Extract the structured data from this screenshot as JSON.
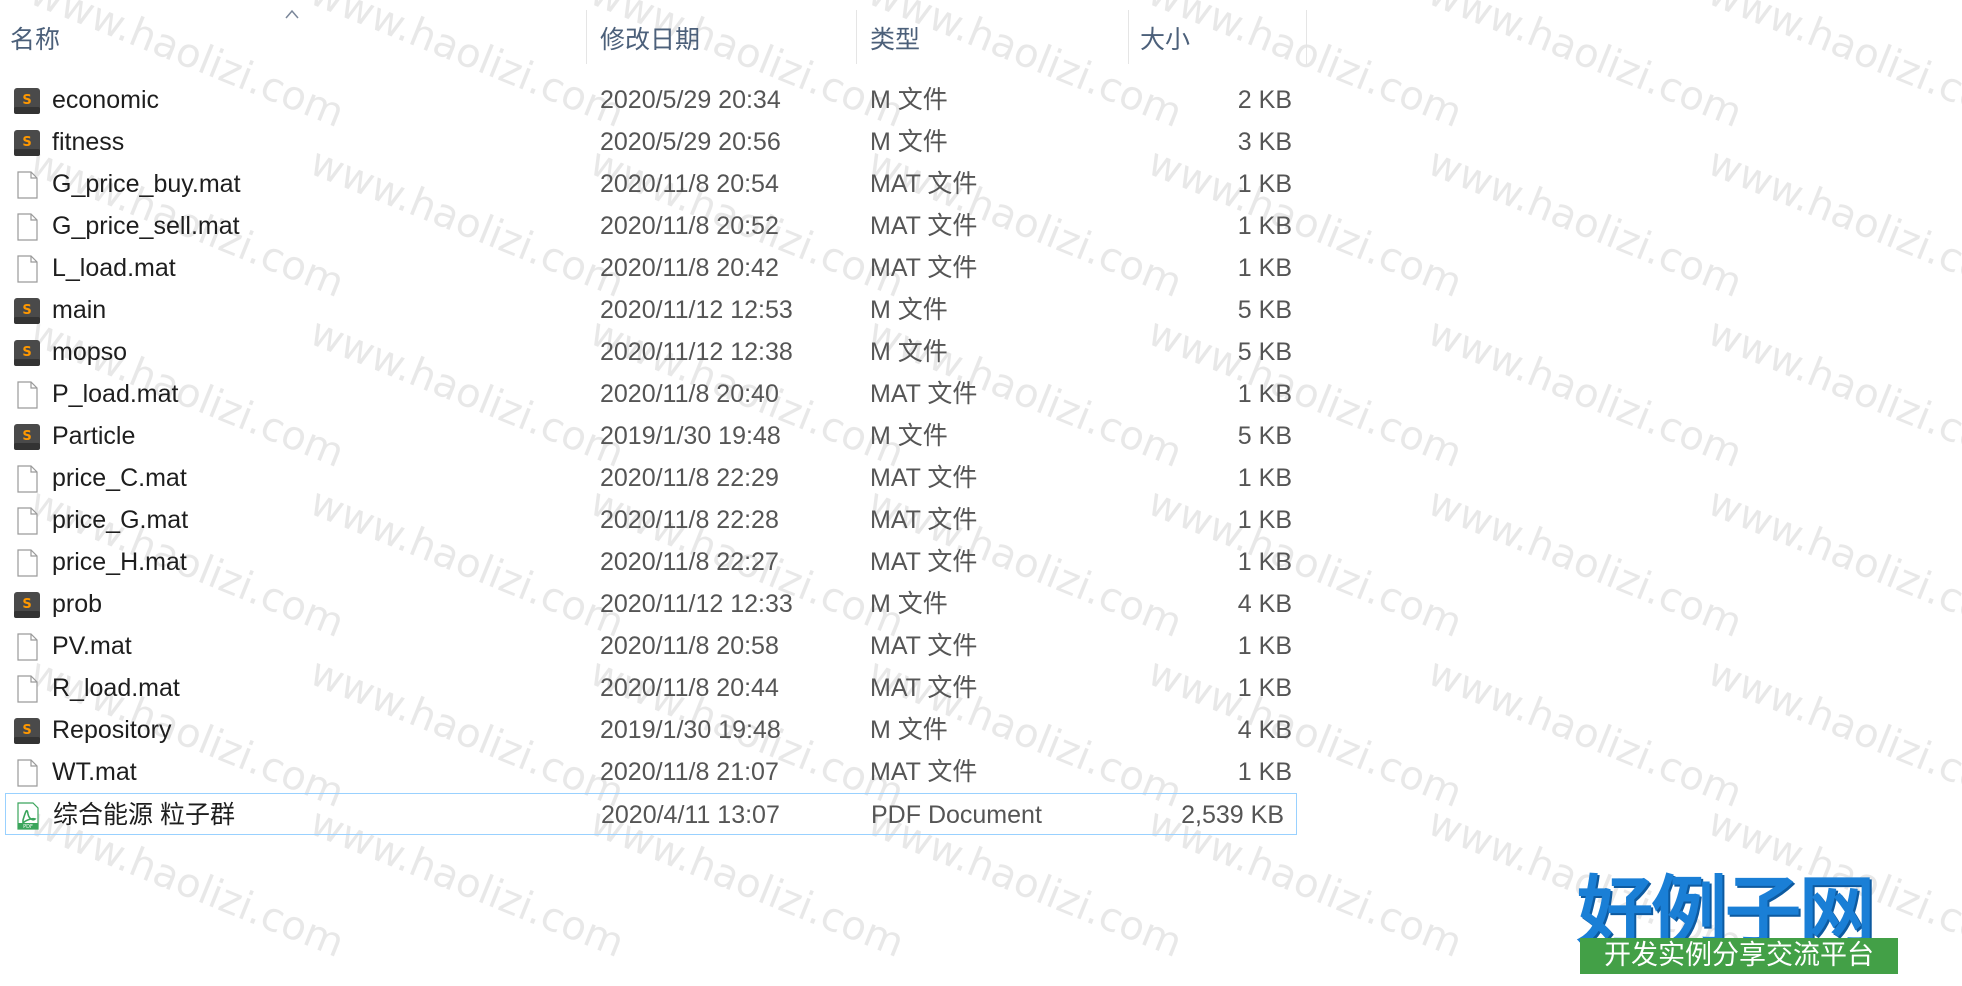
{
  "header": {
    "col_name": "名称",
    "col_date": "修改日期",
    "col_type": "类型",
    "col_size": "大小"
  },
  "files": [
    {
      "name": "economic",
      "date": "2020/5/29 20:34",
      "type": "M 文件",
      "size": "2 KB",
      "icon": "sublime-m-file-icon"
    },
    {
      "name": "fitness",
      "date": "2020/5/29 20:56",
      "type": "M 文件",
      "size": "3 KB",
      "icon": "sublime-m-file-icon"
    },
    {
      "name": "G_price_buy.mat",
      "date": "2020/11/8 20:54",
      "type": "MAT 文件",
      "size": "1 KB",
      "icon": "blank-file-icon"
    },
    {
      "name": "G_price_sell.mat",
      "date": "2020/11/8 20:52",
      "type": "MAT 文件",
      "size": "1 KB",
      "icon": "blank-file-icon"
    },
    {
      "name": "L_load.mat",
      "date": "2020/11/8 20:42",
      "type": "MAT 文件",
      "size": "1 KB",
      "icon": "blank-file-icon"
    },
    {
      "name": "main",
      "date": "2020/11/12 12:53",
      "type": "M 文件",
      "size": "5 KB",
      "icon": "sublime-m-file-icon"
    },
    {
      "name": "mopso",
      "date": "2020/11/12 12:38",
      "type": "M 文件",
      "size": "5 KB",
      "icon": "sublime-m-file-icon"
    },
    {
      "name": "P_load.mat",
      "date": "2020/11/8 20:40",
      "type": "MAT 文件",
      "size": "1 KB",
      "icon": "blank-file-icon"
    },
    {
      "name": "Particle",
      "date": "2019/1/30 19:48",
      "type": "M 文件",
      "size": "5 KB",
      "icon": "sublime-m-file-icon"
    },
    {
      "name": "price_C.mat",
      "date": "2020/11/8 22:29",
      "type": "MAT 文件",
      "size": "1 KB",
      "icon": "blank-file-icon"
    },
    {
      "name": "price_G.mat",
      "date": "2020/11/8 22:28",
      "type": "MAT 文件",
      "size": "1 KB",
      "icon": "blank-file-icon"
    },
    {
      "name": "price_H.mat",
      "date": "2020/11/8 22:27",
      "type": "MAT 文件",
      "size": "1 KB",
      "icon": "blank-file-icon"
    },
    {
      "name": "prob",
      "date": "2020/11/12 12:33",
      "type": "M 文件",
      "size": "4 KB",
      "icon": "sublime-m-file-icon"
    },
    {
      "name": "PV.mat",
      "date": "2020/11/8 20:58",
      "type": "MAT 文件",
      "size": "1 KB",
      "icon": "blank-file-icon"
    },
    {
      "name": "R_load.mat",
      "date": "2020/11/8 20:44",
      "type": "MAT 文件",
      "size": "1 KB",
      "icon": "blank-file-icon"
    },
    {
      "name": "Repository",
      "date": "2019/1/30 19:48",
      "type": "M 文件",
      "size": "4 KB",
      "icon": "sublime-m-file-icon"
    },
    {
      "name": "WT.mat",
      "date": "2020/11/8 21:07",
      "type": "MAT 文件",
      "size": "1 KB",
      "icon": "blank-file-icon"
    },
    {
      "name": "综合能源 粒子群",
      "date": "2020/4/11 13:07",
      "type": "PDF Document",
      "size": "2,539 KB",
      "icon": "pdf-file-icon",
      "selected": true
    }
  ],
  "watermark_text": "www.haolizi.com",
  "logo": {
    "main": "好例子网",
    "sub": "开发实例分享交流平台"
  },
  "colors": {
    "header_text": "#4c607a",
    "selection_border": "#99d1ff",
    "logo_blue": "#1a7fd6",
    "logo_green": "#43a047"
  }
}
